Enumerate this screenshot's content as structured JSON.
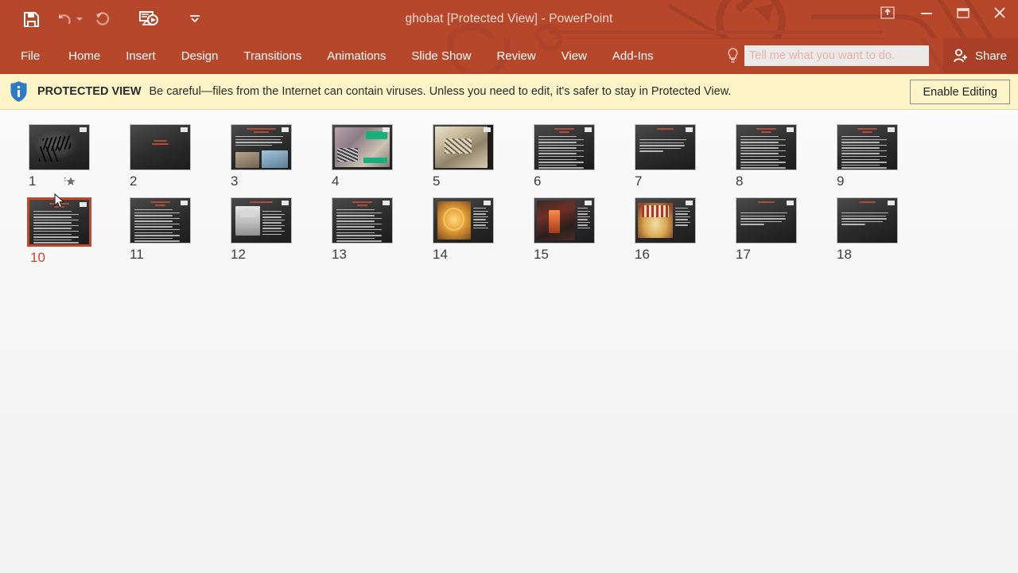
{
  "window": {
    "title": "ghobat [Protected View] - PowerPoint",
    "accent_color": "#b7472a",
    "accent_dark": "#a53f26"
  },
  "quick_access": {
    "items": [
      {
        "name": "save-button",
        "icon": "save-icon",
        "label": "Save",
        "enabled": true
      },
      {
        "name": "undo-button",
        "icon": "undo-icon",
        "label": "Undo",
        "enabled": false
      },
      {
        "name": "redo-button",
        "icon": "redo-icon",
        "label": "Redo",
        "enabled": false
      },
      {
        "name": "start-slideshow-button",
        "icon": "slideshow-icon",
        "label": "Start From Beginning",
        "enabled": true
      },
      {
        "name": "customize-qat-button",
        "icon": "chevron-down-icon",
        "label": "Customize Quick Access Toolbar",
        "enabled": true
      }
    ]
  },
  "window_controls": {
    "ribbon_display_label": "Ribbon Display Options",
    "minimize_label": "Minimize",
    "restore_label": "Restore Down",
    "close_label": "Close"
  },
  "ribbon": {
    "tabs": [
      {
        "label": "File"
      },
      {
        "label": "Home"
      },
      {
        "label": "Insert"
      },
      {
        "label": "Design"
      },
      {
        "label": "Transitions"
      },
      {
        "label": "Animations"
      },
      {
        "label": "Slide Show"
      },
      {
        "label": "Review"
      },
      {
        "label": "View"
      },
      {
        "label": "Add-Ins"
      }
    ],
    "tellme": {
      "placeholder": "Tell me what you want to do.",
      "value": ""
    },
    "share_label": "Share"
  },
  "protected_view": {
    "badge": "PROTECTED VIEW",
    "message": "Be careful—files from the Internet can contain viruses. Unless you need to edit, it's safer to stay in Protected View.",
    "enable_button": "Enable Editing",
    "bar_color": "#fdf5c8"
  },
  "slide_sorter": {
    "selected_slide": 10,
    "selected_color": "#c0492b",
    "slides": [
      {
        "number": "1",
        "kind": "calligraphy",
        "has_animation": true,
        "animation_label": "★"
      },
      {
        "number": "2",
        "kind": "title-only",
        "has_animation": false
      },
      {
        "number": "3",
        "kind": "text-images",
        "has_animation": false
      },
      {
        "number": "4",
        "kind": "photo-full",
        "has_animation": false
      },
      {
        "number": "5",
        "kind": "photo-model",
        "has_animation": false
      },
      {
        "number": "6",
        "kind": "text-dense",
        "has_animation": false
      },
      {
        "number": "7",
        "kind": "text-sparse",
        "has_animation": false
      },
      {
        "number": "8",
        "kind": "text-dense",
        "has_animation": false
      },
      {
        "number": "9",
        "kind": "text-dense",
        "has_animation": false
      },
      {
        "number": "10",
        "kind": "text-dense",
        "has_animation": false
      },
      {
        "number": "11",
        "kind": "text-dense",
        "has_animation": false
      },
      {
        "number": "12",
        "kind": "photo-left",
        "has_animation": false
      },
      {
        "number": "13",
        "kind": "text-dense",
        "has_animation": false
      },
      {
        "number": "14",
        "kind": "photo-dome",
        "has_animation": false
      },
      {
        "number": "15",
        "kind": "photo-lamp",
        "has_animation": false
      },
      {
        "number": "16",
        "kind": "photo-gold",
        "has_animation": false
      },
      {
        "number": "17",
        "kind": "text-sparse",
        "has_animation": false
      },
      {
        "number": "18",
        "kind": "text-sparse",
        "has_animation": false
      }
    ]
  }
}
